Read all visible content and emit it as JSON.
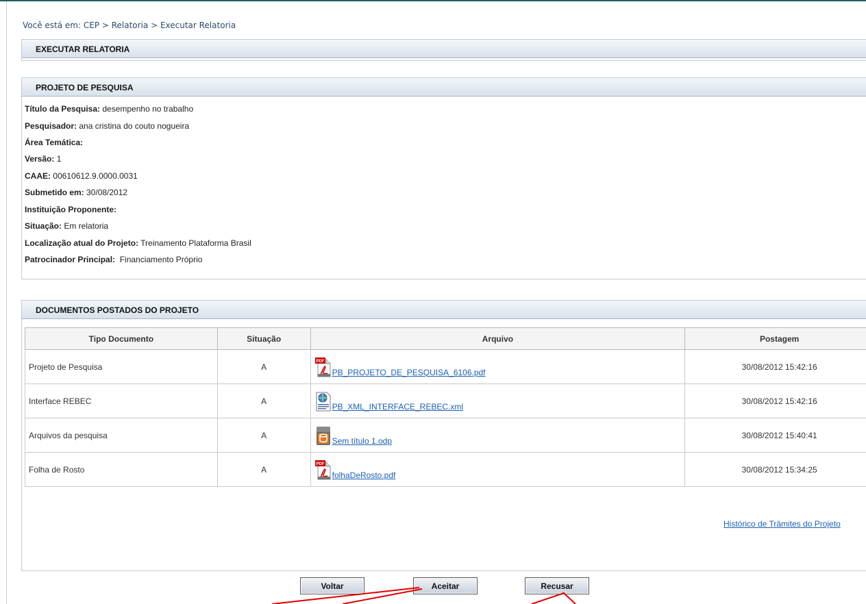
{
  "breadcrumb": "Você está em: CEP > Relatoria > Executar Relatoria",
  "sections": {
    "executar": "EXECUTAR RELATORIA",
    "projeto": "PROJETO DE PESQUISA",
    "documentos": "DOCUMENTOS POSTADOS DO PROJETO"
  },
  "project": {
    "titulo_label": "Título da Pesquisa:",
    "titulo_value": " desempenho no trabalho",
    "pesquisador_label": "Pesquisador:",
    "pesquisador_value": " ana cristina do couto nogueira",
    "area_label": "Área Temática:",
    "versao_label": "Versão:",
    "versao_value": " 1",
    "caae_label": "CAAE:",
    "caae_value": " 00610612.9.0000.0031",
    "submetido_label": "Submetido em:",
    "submetido_value": " 30/08/2012",
    "instituicao_label": "Instituição Proponente:",
    "situacao_label": "Situação:",
    "situacao_value": " Em relatoria",
    "localizacao_label": "Localização atual do Projeto:",
    "localizacao_value": " Treinamento Plataforma Brasil",
    "patrocinador_label": "Patrocinador Principal:",
    "patrocinador_value": "  Financiamento Próprio"
  },
  "table": {
    "headers": [
      "Tipo Documento",
      "Situação",
      "Arquivo",
      "Postagem"
    ],
    "rows": [
      {
        "tipo": "Projeto de Pesquisa",
        "situacao": "A",
        "arquivo": "PB_PROJETO_DE_PESQUISA_6106.pdf",
        "icon": "pdf-icon",
        "postagem": "30/08/2012 15:42:16"
      },
      {
        "tipo": "Interface REBEC",
        "situacao": "A",
        "arquivo": "PB_XML_INTERFACE_REBEC.xml",
        "icon": "xml-icon",
        "postagem": "30/08/2012 15:42:16"
      },
      {
        "tipo": "Arquivos da pesquisa",
        "situacao": "A",
        "arquivo": "Sem título 1.odp",
        "icon": "odp-icon",
        "postagem": "30/08/2012 15:40:41"
      },
      {
        "tipo": "Folha de Rosto",
        "situacao": "A",
        "arquivo": "folhaDeRosto.pdf",
        "icon": "pdf-icon",
        "postagem": "30/08/2012 15:34:25"
      }
    ]
  },
  "historico_link": "Histórico de Trâmites do Projeto",
  "buttons": {
    "voltar": "Voltar",
    "aceitar": "Aceitar",
    "recusar": "Recusar"
  },
  "icons": {
    "pdf_label": "PDF"
  },
  "colors": {
    "header_bg": "#d9e1ea",
    "link": "#1a5fb4",
    "annotation": "#e00000"
  }
}
